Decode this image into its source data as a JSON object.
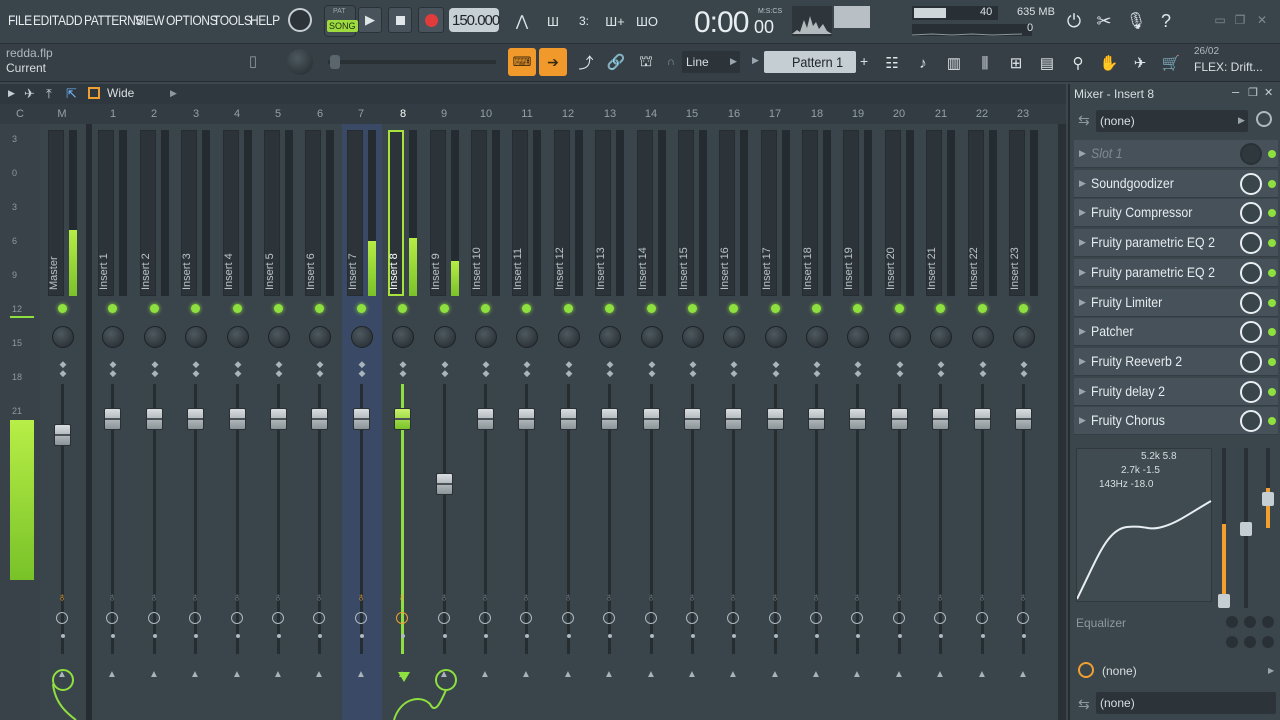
{
  "menu": {
    "file": "FILE",
    "edit": "EDIT",
    "add": "ADD",
    "patterns": "PATTERNS",
    "view": "VIEW",
    "options": "OPTIONS",
    "tools": "TOOLS",
    "help": "HELP"
  },
  "transport": {
    "pat_label": "PAT",
    "song_label": "SONG",
    "tempo": "150.000",
    "time_main": "0:00",
    "time_sub": "00",
    "time_unit": "M:S:CS"
  },
  "status": {
    "cpu_value": "40",
    "memory": "635 MB",
    "poly": "0"
  },
  "project": {
    "file": "redda.flp",
    "hint": "Current"
  },
  "toolbar2": {
    "snap_mode": "Line",
    "pattern_name": "Pattern 1",
    "news_date": "26/02",
    "news_title": "FLEX: Drift..."
  },
  "mixer_bar": {
    "view_mode": "Wide"
  },
  "ruler": [
    "C",
    "M",
    "1",
    "2",
    "3",
    "4",
    "5",
    "6",
    "7",
    "8",
    "9",
    "10",
    "11",
    "12",
    "13",
    "14",
    "15",
    "16",
    "17",
    "18",
    "19",
    "20",
    "21",
    "22",
    "23"
  ],
  "db_scale": [
    "3",
    "0",
    "3",
    "6",
    "9",
    "12",
    "15",
    "18",
    "21"
  ],
  "strips": [
    {
      "name": "Master",
      "level": 0.4,
      "fader": 0.06,
      "active": true
    },
    {
      "name": "Insert 1",
      "level": 0,
      "fader": 0,
      "active": false
    },
    {
      "name": "Insert 2",
      "level": 0,
      "fader": 0,
      "active": false
    },
    {
      "name": "Insert 3",
      "level": 0,
      "fader": 0,
      "active": false
    },
    {
      "name": "Insert 4",
      "level": 0,
      "fader": 0,
      "active": false
    },
    {
      "name": "Insert 5",
      "level": 0,
      "fader": 0,
      "active": false
    },
    {
      "name": "Insert 6",
      "level": 0,
      "fader": 0,
      "active": false
    },
    {
      "name": "Insert 7",
      "level": 0.33,
      "fader": 0,
      "active": true
    },
    {
      "name": "Insert 8",
      "level": 0.35,
      "fader": 0,
      "active": true
    },
    {
      "name": "Insert 9",
      "level": 0.21,
      "fader": 0.25,
      "active": false
    },
    {
      "name": "Insert 10",
      "level": 0,
      "fader": 0,
      "active": false
    },
    {
      "name": "Insert 11",
      "level": 0,
      "fader": 0,
      "active": false
    },
    {
      "name": "Insert 12",
      "level": 0,
      "fader": 0,
      "active": false
    },
    {
      "name": "Insert 13",
      "level": 0,
      "fader": 0,
      "active": false
    },
    {
      "name": "Insert 14",
      "level": 0,
      "fader": 0,
      "active": false
    },
    {
      "name": "Insert 15",
      "level": 0,
      "fader": 0,
      "active": false
    },
    {
      "name": "Insert 16",
      "level": 0,
      "fader": 0,
      "active": false
    },
    {
      "name": "Insert 17",
      "level": 0,
      "fader": 0,
      "active": false
    },
    {
      "name": "Insert 18",
      "level": 0,
      "fader": 0,
      "active": false
    },
    {
      "name": "Insert 19",
      "level": 0,
      "fader": 0,
      "active": false
    },
    {
      "name": "Insert 20",
      "level": 0,
      "fader": 0,
      "active": false
    },
    {
      "name": "Insert 21",
      "level": 0,
      "fader": 0,
      "active": false
    },
    {
      "name": "Insert 22",
      "level": 0,
      "fader": 0,
      "active": false
    },
    {
      "name": "Insert 23",
      "level": 0,
      "fader": 0,
      "active": false
    }
  ],
  "panel": {
    "title": "Mixer - Insert 8",
    "input": "(none)",
    "slots": [
      {
        "name": "Slot 1",
        "empty": true
      },
      {
        "name": "Soundgoodizer"
      },
      {
        "name": "Fruity Compressor"
      },
      {
        "name": "Fruity parametric EQ 2"
      },
      {
        "name": "Fruity parametric EQ 2"
      },
      {
        "name": "Fruity Limiter"
      },
      {
        "name": "Patcher"
      },
      {
        "name": "Fruity Reeverb 2"
      },
      {
        "name": "Fruity delay 2"
      },
      {
        "name": "Fruity Chorus"
      }
    ],
    "eq_label": "Equalizer",
    "eq_readouts": [
      "5.2k 5.8",
      "2.7k -1.5",
      "143Hz -18.0"
    ],
    "output_top": "(none)",
    "output_bottom": "(none)"
  },
  "colors": {
    "accent": "#8ee03f",
    "selected_strip": "#3a4a66",
    "orange": "#f0a030"
  }
}
